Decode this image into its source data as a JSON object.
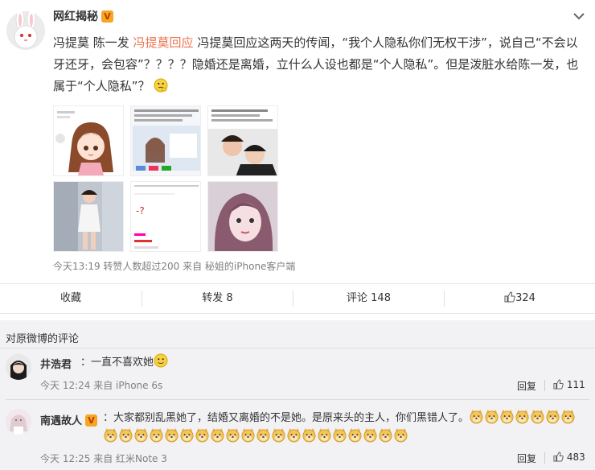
{
  "post": {
    "author": "网红揭秘",
    "verified_badge": "V",
    "text_prefix": "冯提莫 陈一发 ",
    "text_link": "冯提莫回应",
    "text_body": " 冯提莫回应这两天的传闻，“我个人隐私你们无权干涉”，说自己“不会以牙还牙，会包容”？？？？隐婚还是离婚，立什么人设也都是“个人隐私”。但是泼脏水给陈一发，也属于“个人隐私”？",
    "images": [
      "cartoon-girl-image",
      "screenshot-collage-image",
      "couple-photo-image",
      "girl-full-body-image",
      "text-screenshot-image",
      "girl-selfie-image"
    ],
    "meta": "今天13:19 转赞人数超过200 来自 秘姐的iPhone客户端",
    "accent_color": "#eb7350"
  },
  "actions": {
    "favorite": "收藏",
    "repost": "转发 8",
    "comment": "评论 148",
    "like": "324"
  },
  "comments": {
    "title": "对原微博的评论",
    "items": [
      {
        "name": "井浩君",
        "text": "：一直不喜欢她",
        "meta": "今天 12:24 来自 iPhone 6s",
        "reply": "回复",
        "likes": "111"
      },
      {
        "name": "南遇故人",
        "badge": "V",
        "text": "：大家都别乱黑她了，结婚又离婚的不是她。是原来头的主人，你们黑错人了。",
        "meta": "今天 12:25 来自 红米Note 3",
        "reply": "回复",
        "likes": "483"
      }
    ]
  }
}
